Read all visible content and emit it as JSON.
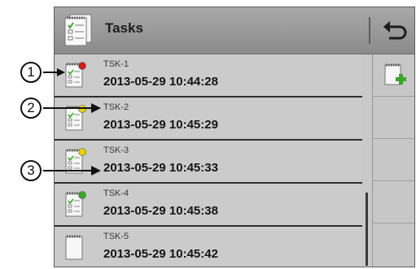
{
  "header": {
    "title": "Tasks",
    "icon": "task-list-icon",
    "back_icon": "back-icon"
  },
  "tasks": [
    {
      "id": "TSK-1",
      "datetime": "2013-05-29 10:44:28",
      "status_color": "#cc1f1f"
    },
    {
      "id": "TSK-2",
      "datetime": "2013-05-29 10:45:29",
      "status_color": "#e8d200"
    },
    {
      "id": "TSK-3",
      "datetime": "2013-05-29 10:45:33",
      "status_color": "#e8d200"
    },
    {
      "id": "TSK-4",
      "datetime": "2013-05-29 10:45:38",
      "status_color": "#3aa52a"
    },
    {
      "id": "TSK-5",
      "datetime": "2013-05-29 10:45:42",
      "status_color": null
    }
  ],
  "side": {
    "add_icon": "add-task-icon"
  },
  "callouts": [
    "1",
    "2",
    "3"
  ]
}
